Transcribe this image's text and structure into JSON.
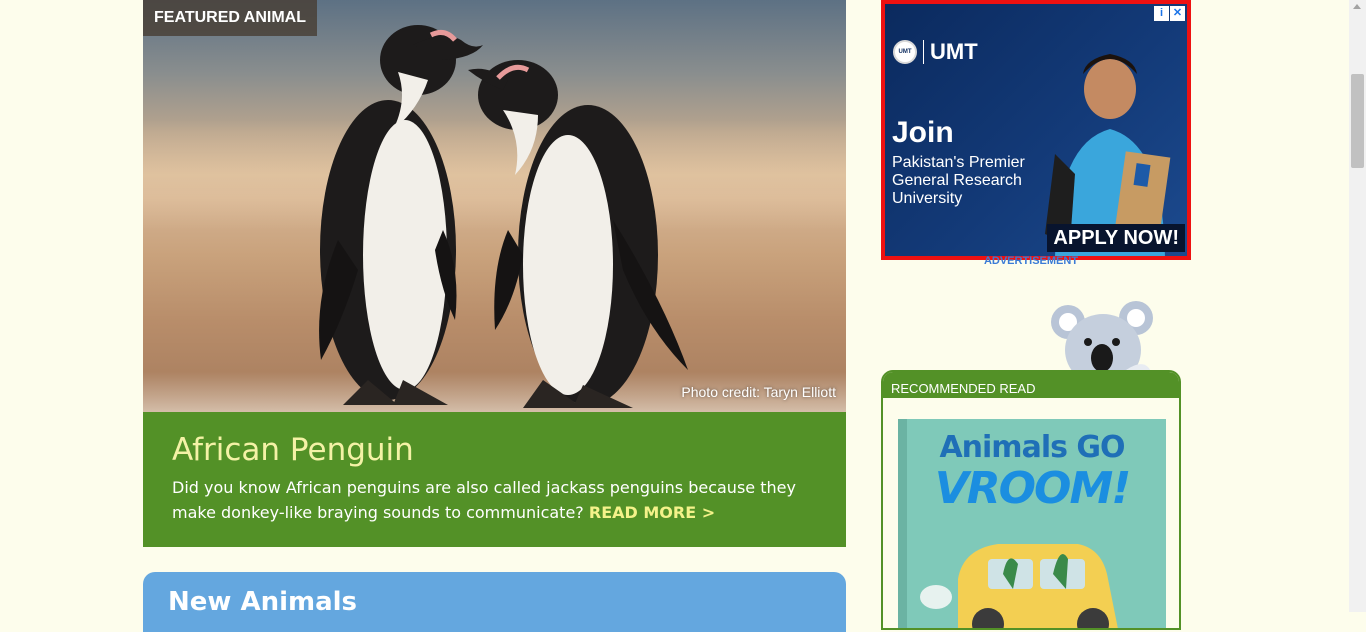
{
  "featured": {
    "badge": "FEATURED ANIMAL",
    "photo_credit": "Photo credit: Taryn Elliott",
    "title": "African Penguin",
    "description": "Did you know African penguins are also called jackass penguins because they make donkey-like braying sounds to communicate?",
    "read_more": "READ MORE >",
    "caption_color": "#539127",
    "title_color": "#f4f2a6"
  },
  "new_animals": {
    "heading": "New Animals",
    "color": "#64a7df"
  },
  "ad": {
    "brand": "UMT",
    "seal_text": "UMT",
    "headline": "Join",
    "tagline": "Pakistan's Premier General Research University",
    "cta": "APPLY NOW!",
    "info_icon": "i",
    "close_icon": "✕",
    "label": "ADVERTISEMENT",
    "border_color": "#ee1111"
  },
  "recommended": {
    "heading": "RECOMMENDED READ",
    "book_title_line1": "Animals GO",
    "book_title_line2": "VROOM!",
    "color": "#539127"
  }
}
